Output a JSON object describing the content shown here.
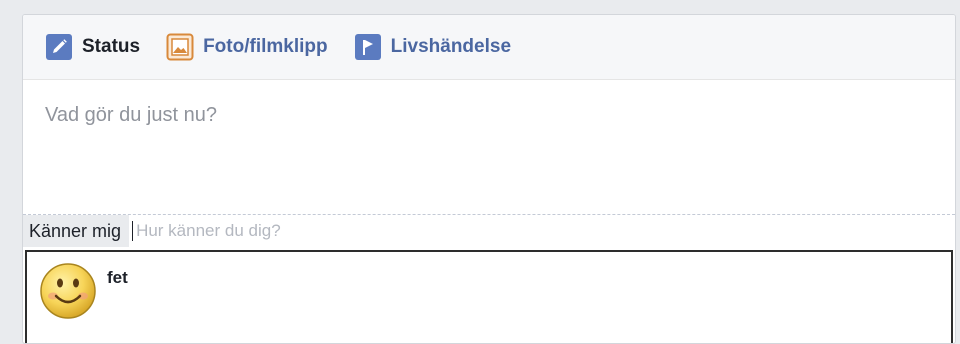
{
  "composer": {
    "tabs": [
      {
        "label": "Status",
        "icon": "pencil-icon",
        "active": true
      },
      {
        "label": "Foto/filmklipp",
        "icon": "photo-icon",
        "active": false
      },
      {
        "label": "Livshändelse",
        "icon": "flag-icon",
        "active": false
      }
    ],
    "textarea": {
      "placeholder": "Vad gör du just nu?"
    },
    "feeling": {
      "tag_label": "Känner mig",
      "input_placeholder": "Hur känner du dig?",
      "input_value": ""
    },
    "suggestions": [
      {
        "label": "fet",
        "icon": "smiley-icon"
      }
    ]
  },
  "colors": {
    "tab_blue": "#4b67a1",
    "icon_blue": "#5b7bc0",
    "photo_orange": "#d8893b"
  }
}
